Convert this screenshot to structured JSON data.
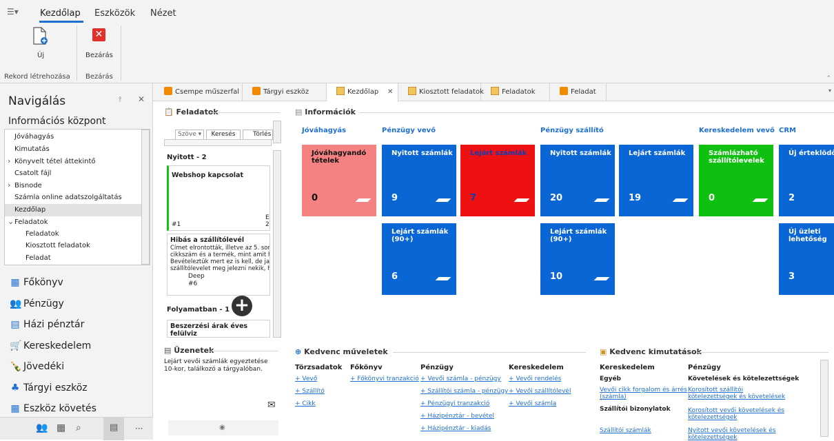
{
  "ribbon": {
    "tabs": [
      "Kezdőlap",
      "Eszközök",
      "Nézet"
    ],
    "new_label": "Új",
    "close_label": "Bezárás",
    "group_record": "Rekord létrehozása",
    "group_close": "Bezárás"
  },
  "nav": {
    "title": "Navigálás",
    "section": "Információs központ",
    "tree": [
      {
        "label": "Jóváhagyás",
        "indent": 0,
        "arrow": ""
      },
      {
        "label": "Kimutatás",
        "indent": 0,
        "arrow": ""
      },
      {
        "label": "Könyvelt tétel áttekintő",
        "indent": 0,
        "arrow": "›"
      },
      {
        "label": "Csatolt fájl",
        "indent": 0,
        "arrow": ""
      },
      {
        "label": "Bisnode",
        "indent": 0,
        "arrow": "›"
      },
      {
        "label": "Számla online adatszolgáltatás",
        "indent": 0,
        "arrow": ""
      },
      {
        "label": "Kezdőlap",
        "indent": 0,
        "arrow": "",
        "selected": true
      },
      {
        "label": "Feladatok",
        "indent": 0,
        "arrow": "⌄"
      },
      {
        "label": "Feladatok",
        "indent": 1,
        "arrow": ""
      },
      {
        "label": "Kiosztott feladatok",
        "indent": 1,
        "arrow": ""
      },
      {
        "label": "Feladat",
        "indent": 1,
        "arrow": ""
      }
    ],
    "modules": [
      "Főkönyv",
      "Pénzügy",
      "Házi pénztár",
      "Kereskedelem",
      "Jövedéki",
      "Tárgyi eszköz",
      "Eszköz követés"
    ],
    "bottom_more": "···"
  },
  "doctabs": [
    "Csempe műszerfal",
    "Tárgyi eszköz",
    "Kezdőlap",
    "Kiosztott feladatok",
    "Feladatok",
    "Feladat"
  ],
  "tasks": {
    "title": "Feladatok",
    "filter": "Szöve",
    "search": "Keresés",
    "clear": "Törlés",
    "open_group": "Nyitott - 2",
    "card1_title": "Webshop kapcsolat",
    "card1_id": "#1",
    "card1_side1": "E",
    "card1_side2": "20",
    "card2_title": "Hibás a szállítólevél",
    "card2_text": [
      "Címet elrontották, illetve az 5. sor",
      "cikkszám és a termék, mint amit ho",
      "Bevételeztük mert ez is kell, de jav",
      "szállítólevelet meg jelezni nekik, ho"
    ],
    "card2_user": "Deep",
    "card2_id": "#6",
    "progress_group": "Folyamatban - 1",
    "card3_title": "Beszerzési árak éves felülviz"
  },
  "messages": {
    "title": "Üzenetek",
    "text": [
      "Lejárt vevői számlák egyeztetése",
      "10-kor, találkozó a tárgyalóban."
    ]
  },
  "info": {
    "title": "Információk",
    "columns": [
      "Jóváhagyás",
      "Pénzügy vevő",
      "Pénzügy szállító",
      "Kereskedelem vevő",
      "CRM"
    ],
    "tiles": [
      {
        "label": "Jóváhagyandó tételek",
        "value": "0",
        "color": "#f48282",
        "text": "#111"
      },
      {
        "label": "Nyitott számlák",
        "value": "9",
        "color": "#0a66d4",
        "text": "#fff"
      },
      {
        "label": "Lejárt számlák",
        "value": "7",
        "color": "#ee1111",
        "text": "#0a3fb8"
      },
      {
        "label": "Nyitott számlák",
        "value": "20",
        "color": "#0a66d4",
        "text": "#fff"
      },
      {
        "label": "Lejárt számlák",
        "value": "19",
        "color": "#0a66d4",
        "text": "#fff"
      },
      {
        "label": "Számlázható szállítólevelek",
        "value": "0",
        "color": "#10c010",
        "text": "#fff"
      },
      {
        "label": "Új érteklödők",
        "value": "2",
        "color": "#0a66d4",
        "text": "#fff"
      },
      {
        "label": "Lejárt számlák (90+)",
        "value": "6",
        "color": "#0a66d4",
        "text": "#fff"
      },
      {
        "label": "Lejárt számlák (90+)",
        "value": "10",
        "color": "#0a66d4",
        "text": "#fff"
      },
      {
        "label": "Új üzleti lehetőség",
        "value": "3",
        "color": "#0a66d4",
        "text": "#fff"
      }
    ]
  },
  "favops": {
    "title": "Kedvenc műveletek",
    "h1": "Törzsadatok",
    "h2": "Főkönyv",
    "h3": "Pénzügy",
    "h4": "Kereskedelem",
    "c1": [
      "+ Vevő",
      "+ Szállító",
      "+ Cikk"
    ],
    "c2": [
      "+ Főkönyvi tranzakció"
    ],
    "c3": [
      "+ Vevői számla - pénzügy",
      "+ Szállítói számla - pénzügy",
      "+ Pénzügyi tranzakció",
      "+ Házipénztár - bevétel",
      "+ Házipénztár - kiadás"
    ],
    "c4": [
      "+ Vevői rendelés",
      "+ Vevői szállítólevél",
      "+ Vevői számla"
    ]
  },
  "favreports": {
    "title": "Kedvenc kimutatások",
    "h1": "Kereskedelem",
    "h2": "Pénzügy",
    "sub1": "Egyéb",
    "sub2": "Követelések és kötelezettségek",
    "sub3": "Szállítói bizonylatok",
    "l1a": "Vevői cikk forgalom és árrés",
    "l1b": "(számla)",
    "l2": "Szállítói számlák",
    "r1a": "Korosított szállítói",
    "r1b": "kötelezettségek és követelések",
    "r2a": "Korosított vevői követelések és",
    "r2b": "kötelezettségek",
    "r3a": "Nyitott vevői követelések és",
    "r3b": "kötelezettségek"
  }
}
